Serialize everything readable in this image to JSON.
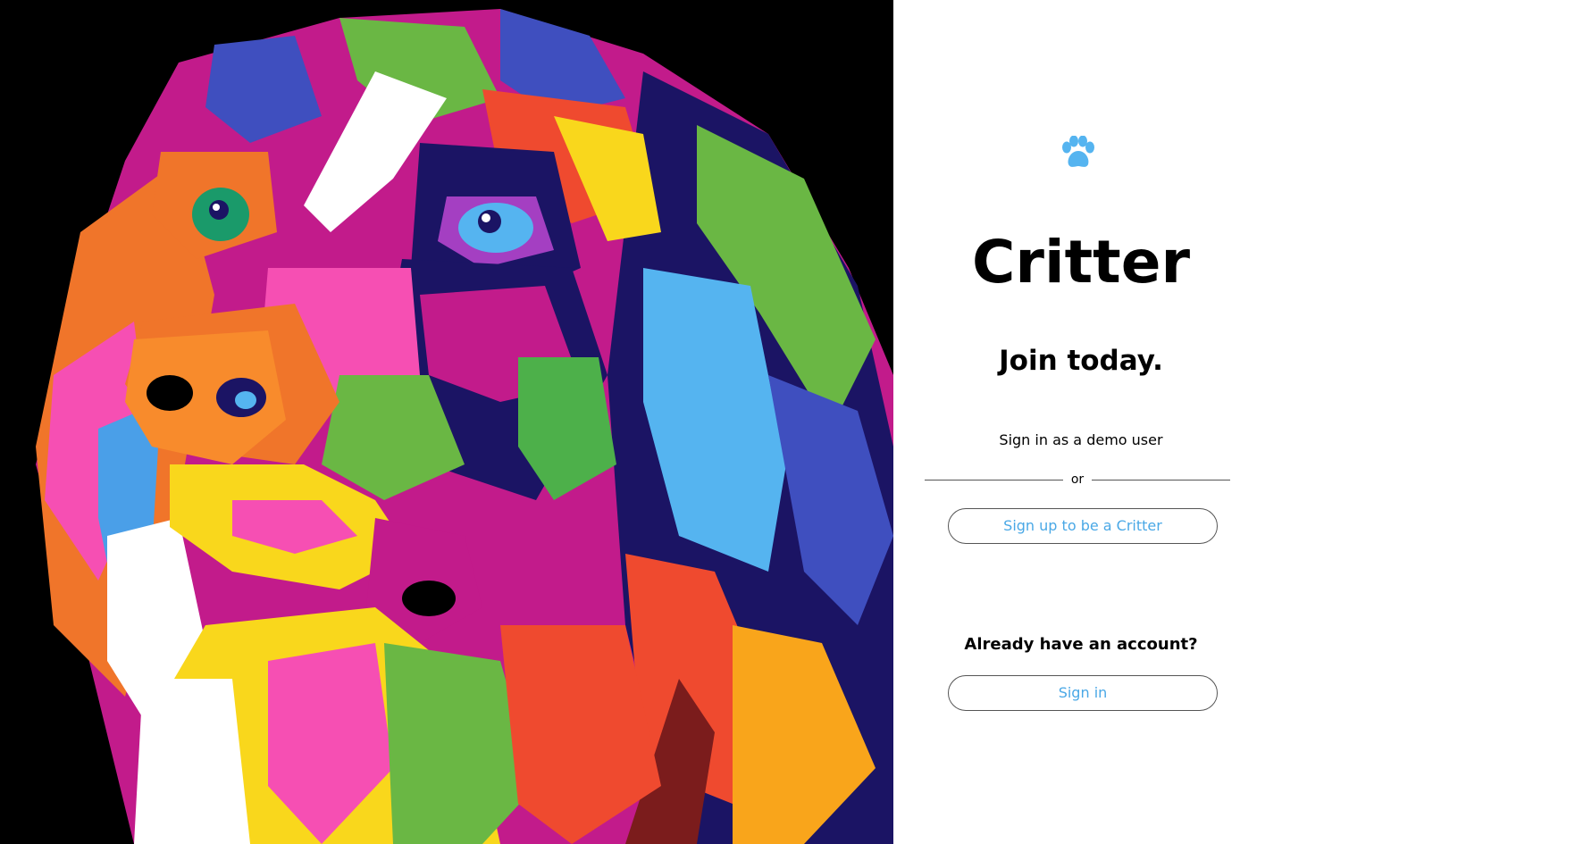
{
  "brand": {
    "name": "Critter",
    "icon": "paw-icon",
    "accent": "#55b4f0"
  },
  "landing": {
    "tagline": "Join today.",
    "demo_link": "Sign in as a demo user",
    "divider_text": "or",
    "signup_button": "Sign up to be a Critter",
    "account_prompt": "Already have an account?",
    "signin_button": "Sign in"
  },
  "hero": {
    "image": "colorful-dog-portrait"
  }
}
